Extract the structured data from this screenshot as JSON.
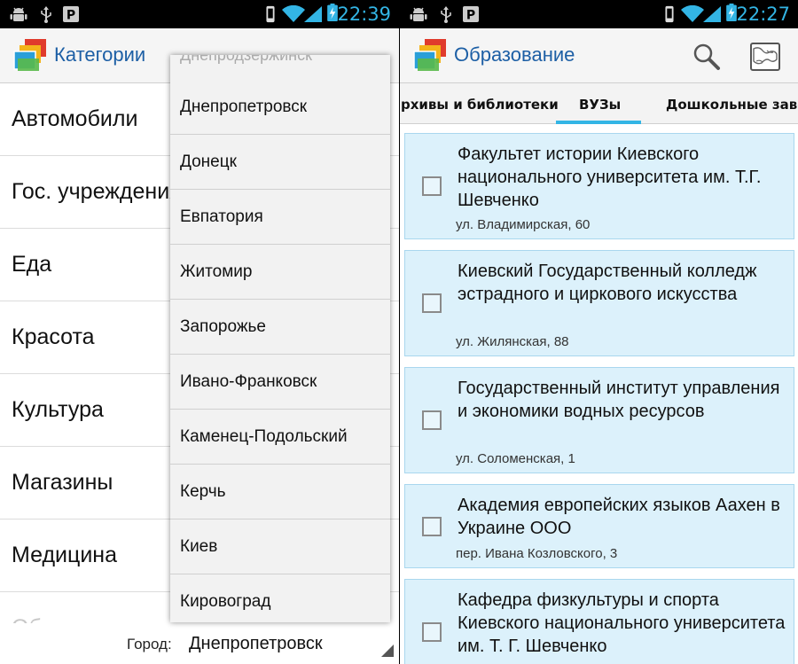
{
  "left_screen": {
    "status": {
      "time": "22:39"
    },
    "action_bar": {
      "title": "Категории"
    },
    "categories": [
      "Автомобили",
      "Гос. учреждения",
      "Еда",
      "Красота",
      "Культура",
      "Магазины",
      "Медицина"
    ],
    "categories_faded": "Об",
    "city_selector": {
      "label": "Город:",
      "value": "Днепропетровск"
    },
    "dropdown": {
      "partial_item": "Днепродзержинск",
      "items": [
        "Днепропетровск",
        "Донецк",
        "Евпатория",
        "Житомир",
        "Запорожье",
        "Ивано-Франковск",
        "Каменец-Подольский",
        "Керчь",
        "Киев",
        "Кировоград"
      ]
    }
  },
  "right_screen": {
    "status": {
      "time": "22:27"
    },
    "action_bar": {
      "title": "Образование",
      "search_icon": "search-icon",
      "map_icon": "map-icon"
    },
    "tabs": [
      {
        "label": "рхивы и библиотеки"
      },
      {
        "label": "ВУЗы",
        "selected": true
      },
      {
        "label": "Дошкольные завед"
      }
    ],
    "accent_color": "#33b5e5",
    "cards": [
      {
        "title": "Факультет истории Киевского национального университета им. Т.Г. Шевченко",
        "address": "ул. Владимирская, 60"
      },
      {
        "title": "Киевский Государственный колледж эстрадного и циркового искусства",
        "address": "ул. Жилянская, 88"
      },
      {
        "title": "Государственный институт управления и экономики водных ресурсов",
        "address": "ул. Соломенская, 1"
      },
      {
        "title": "Академия европейских языков Аахен в Украине ООО",
        "address": "пер. Ивана Козловского, 3"
      },
      {
        "title": "Кафедра физкультуры и спорта Киевского национального университета им. Т. Г. Шевченко",
        "address": ""
      }
    ]
  }
}
